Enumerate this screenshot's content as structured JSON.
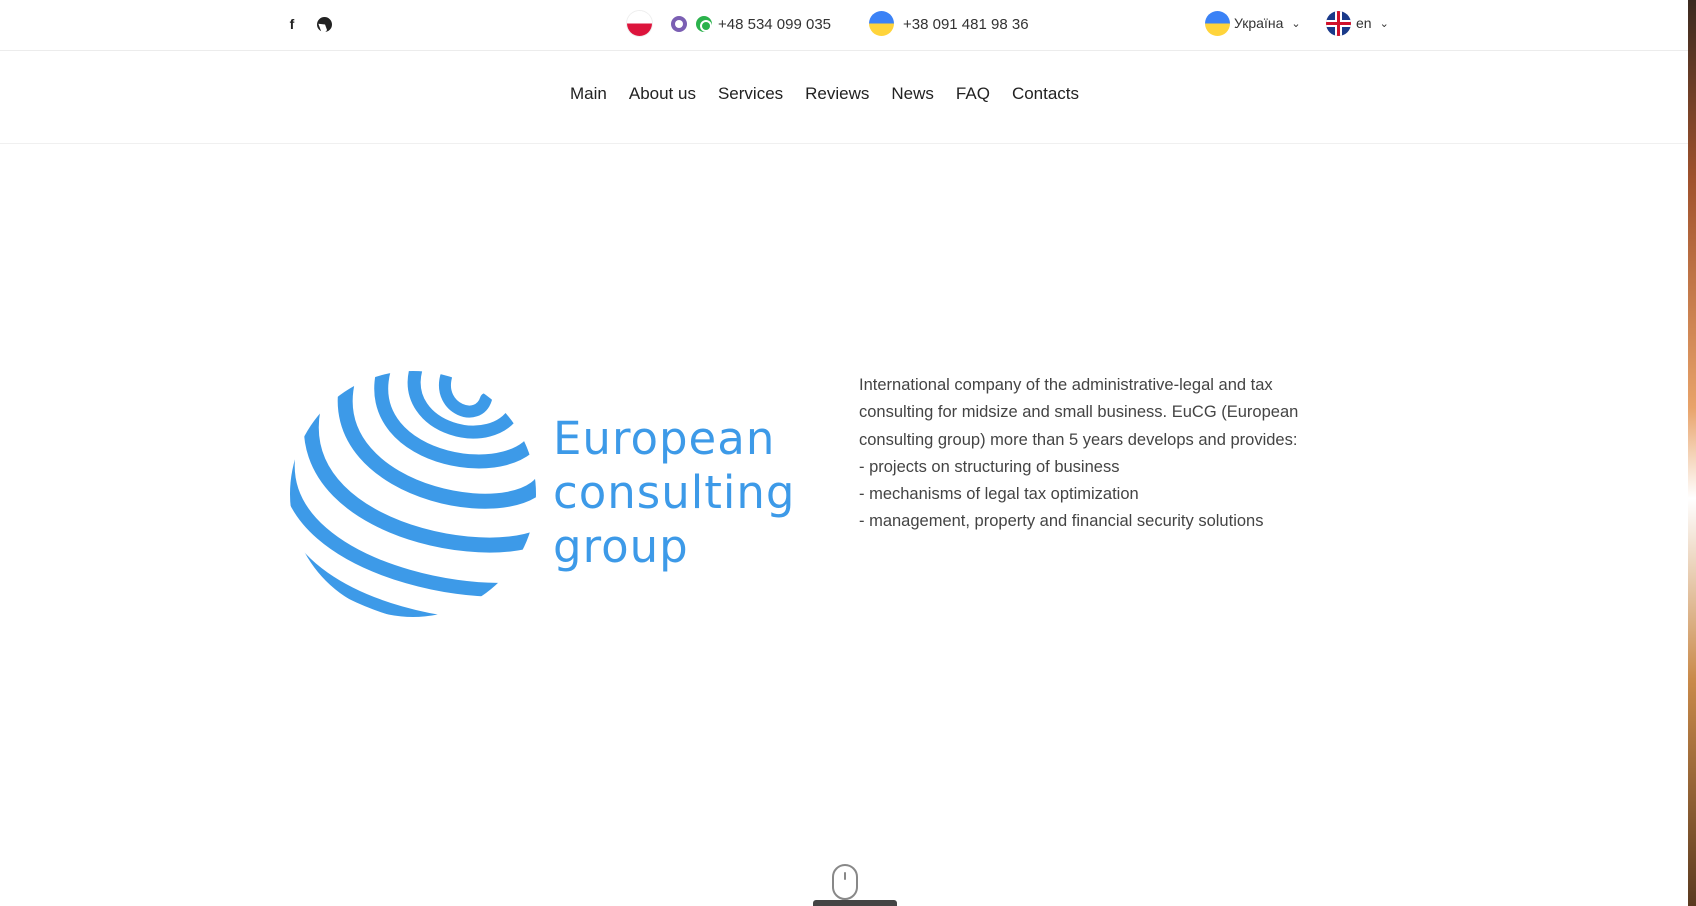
{
  "topbar": {
    "social": [
      {
        "icon": "facebook-icon",
        "glyph": "f"
      },
      {
        "icon": "telegram-icon"
      }
    ],
    "phones": [
      {
        "flag": "poland-flag",
        "messengers": [
          "viber-icon",
          "whatsapp-icon"
        ],
        "number": "+48 534 099 035"
      },
      {
        "flag": "ukraine-flag",
        "number": "+38 091 481 98 36"
      }
    ],
    "country": {
      "flag": "ukraine-flag",
      "label": "Україна"
    },
    "language": {
      "flag": "uk-flag",
      "label": "en"
    }
  },
  "nav": {
    "items": [
      {
        "label": "Main"
      },
      {
        "label": "About us"
      },
      {
        "label": "Services"
      },
      {
        "label": "Reviews"
      },
      {
        "label": "News"
      },
      {
        "label": "FAQ"
      },
      {
        "label": "Contacts"
      }
    ]
  },
  "hero": {
    "logo": {
      "lines": [
        "European",
        "consulting",
        "group"
      ],
      "color": "#3d9ae8"
    },
    "description": [
      "International company of the administrative-legal and tax",
      "consulting for midsize and small business. EuCG (European",
      "consulting group) more than 5 years develops and provides:",
      "- projects on structuring of business",
      "- mechanisms of legal tax optimization",
      "- management, property and financial security solutions"
    ]
  },
  "scroll_indicator": {
    "icon": "mouse-scroll-icon"
  }
}
